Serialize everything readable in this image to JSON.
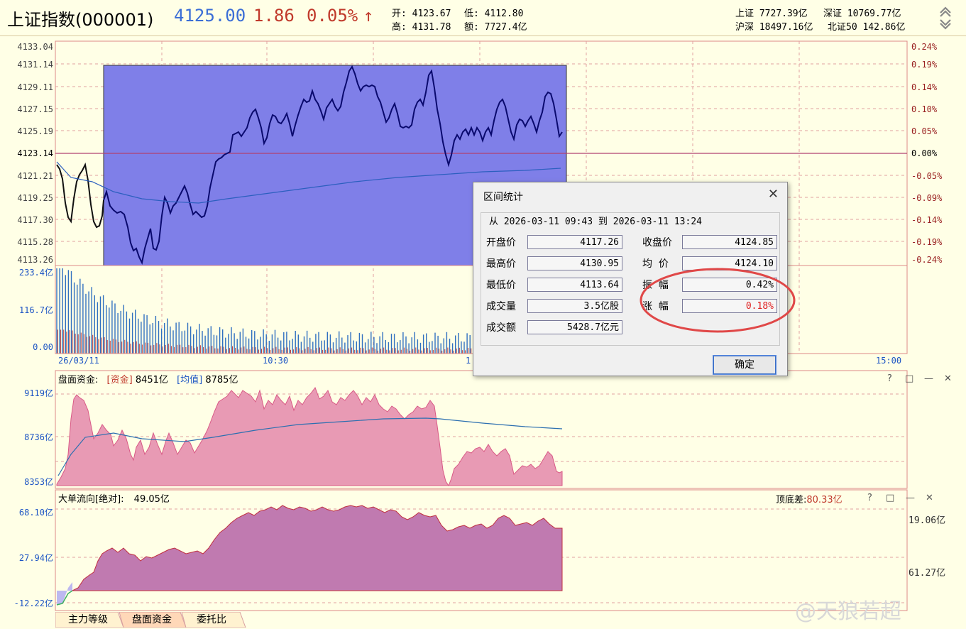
{
  "header": {
    "title": "上证指数(000001)",
    "price": "4125.00",
    "change": "1.86",
    "change_pct": "0.05%",
    "arrow": "↑",
    "open_label": "开:",
    "open_value": "4123.67",
    "low_label": "低:",
    "low_value": "4112.80",
    "high_label": "高:",
    "high_value": "4131.78",
    "amount_label": "额:",
    "amount_value": "7727.4亿",
    "sh_label": "上证",
    "sh_value": "7727.39亿",
    "sz_label": "深证",
    "sz_value": "10769.77亿",
    "hs_label": "沪深",
    "hs_value": "18497.16亿",
    "bz_label": "北证50",
    "bz_value": "142.86亿"
  },
  "price_axis": {
    "left": [
      "4133.04",
      "4131.14",
      "4129.11",
      "4127.15",
      "4125.19",
      "4123.14",
      "4121.21",
      "4119.25",
      "4117.30",
      "4115.28",
      "4113.26"
    ],
    "right": [
      "0.24%",
      "0.19%",
      "0.14%",
      "0.10%",
      "0.05%",
      "0.00%",
      "-0.05%",
      "-0.09%",
      "-0.14%",
      "-0.19%",
      "-0.24%"
    ]
  },
  "volume_axis": [
    "233.4亿",
    "116.7亿",
    "0.00"
  ],
  "time_axis": [
    "26/03/11",
    "10:30",
    "1",
    "15:00"
  ],
  "panel2": {
    "title": "盘面资金:",
    "fund_label": "[资金]",
    "fund_value": "8451亿",
    "avg_label": "[均值]",
    "avg_value": "8785亿",
    "axis": [
      "9119亿",
      "8736亿",
      "8353亿"
    ]
  },
  "panel3": {
    "title": "大单流向[绝对]:",
    "value": "49.05亿",
    "spread_label": "顶底差:",
    "spread_value": "80.33亿",
    "axis": [
      "68.10亿",
      "27.94亿",
      "-12.22亿"
    ],
    "right_axis": [
      "19.06亿",
      "61.27亿"
    ]
  },
  "dialog": {
    "title": "区间统计",
    "close": "✕",
    "range_from": "从",
    "range_start": "2026-03-11 09:43",
    "range_to": "到",
    "range_end": "2026-03-11 13:24",
    "fields": {
      "open_label": "开盘价",
      "open": "4117.26",
      "close_label": "收盘价",
      "close": "4124.85",
      "high_label": "最高价",
      "high": "4130.95",
      "avg_label": "均  价",
      "avg": "4124.10",
      "low_label": "最低价",
      "low": "4113.64",
      "amp_label": "振  幅",
      "amp": "0.42%",
      "vol_label": "成交量",
      "vol": "3.5亿股",
      "chg_label": "涨  幅",
      "chg": "0.18%",
      "amt_label": "成交额",
      "amt": "5428.7亿元"
    },
    "ok": "确定"
  },
  "tabs": [
    "主力等级",
    "盘面资金",
    "委托比"
  ],
  "controls": {
    "help": "?",
    "max": "□",
    "min": "—",
    "close": "✕"
  },
  "watermark": "@天狼若超",
  "colors": {
    "price_line": "#0a0a6e",
    "selection": "#7f7fe8",
    "fund_fill": "#e89ab4",
    "flow_fill": "#c07ab0",
    "accent_red": "#c0392b"
  }
}
